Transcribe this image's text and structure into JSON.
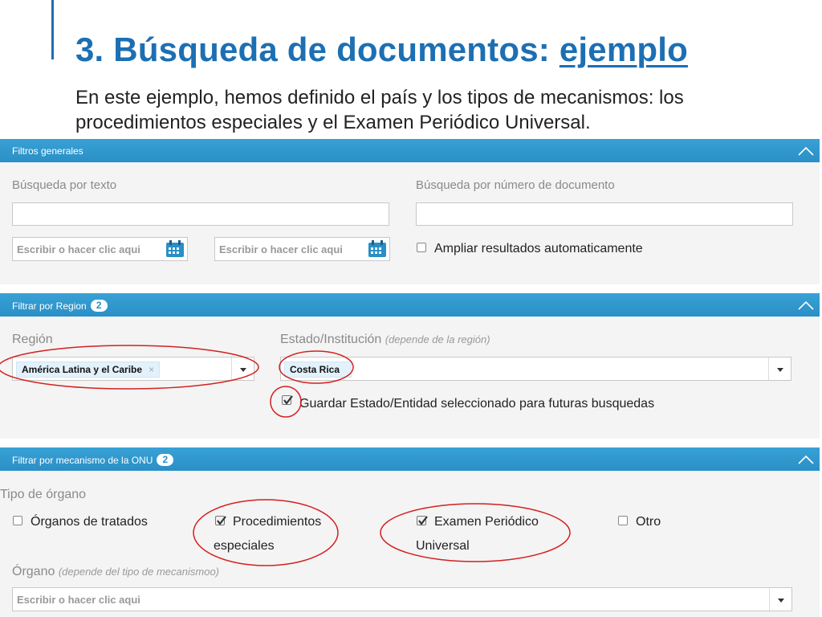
{
  "slide": {
    "title_prefix": "3. Búsqueda de documentos: ",
    "title_link": "ejemplo",
    "subtitle": "En este ejemplo, hemos definido el país y los tipos de mecanismos: los procedimientos especiales y el Examen Periódico Universal."
  },
  "general_filters": {
    "header": "Filtros generales",
    "text_search_label": "Búsqueda por texto",
    "text_search_value": "",
    "doc_number_label": "Búsqueda por número de documento",
    "doc_number_value": "",
    "date_from_placeholder": "Escribir o hacer clic aqui",
    "date_to_placeholder": "Escribir o hacer clic aqui",
    "expand_results_label": "Ampliar resultados automaticamente",
    "expand_results_checked": false
  },
  "region_filter": {
    "header": "Filtrar por Region",
    "badge": "2",
    "region_label": "Región",
    "region_tag": "América Latina y el Caribe",
    "tag_remove": "×",
    "state_label": "Estado/Institución",
    "state_hint": "(depende de la región)",
    "state_tag": "Costa Rica",
    "save_state_label": "Guardar Estado/Entidad seleccionado para futuras busquedas",
    "save_state_checked": true
  },
  "mechanism_filter": {
    "header": "Filtrar por mecanismo de la ONU",
    "badge": "2",
    "organ_type_label": "Tipo de órgano",
    "options": [
      {
        "label_line1": "Órganos de tratados",
        "label_line2": "",
        "checked": false
      },
      {
        "label_line1": "Procedimientos",
        "label_line2": "especiales",
        "checked": true
      },
      {
        "label_line1": "Examen Periódico",
        "label_line2": "Universal",
        "checked": true
      },
      {
        "label_line1": "Otro",
        "label_line2": "",
        "checked": false
      }
    ],
    "organ_label": "Órgano",
    "organ_hint": "(depende del tipo de mecanismoo)",
    "organ_placeholder": "Escribir o hacer clic aqui"
  },
  "colors": {
    "title_blue": "#1d6fb3",
    "bar_blue": "#2a8fc6",
    "annotation_red": "#d42020"
  },
  "icons": [
    "calendar-icon",
    "chevron-up-icon",
    "caret-down-icon",
    "checkmark-icon",
    "tag-remove-icon"
  ]
}
